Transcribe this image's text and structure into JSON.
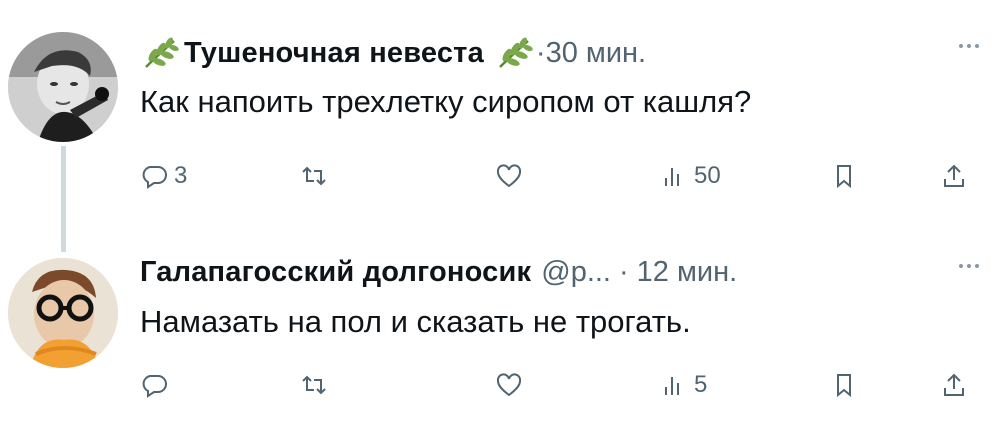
{
  "tweets": [
    {
      "author_name": "Тушеночная невеста",
      "handle": "",
      "time": "30 мин.",
      "text": "Как напоить трехлетку сиропом от кашля?",
      "replies": "3",
      "retweets": "",
      "likes": "",
      "views": "50"
    },
    {
      "author_name": "Галапагосский долгоносик",
      "handle": "@p...",
      "time": "12 мин.",
      "text": "Намазать на пол и сказать не трогать.",
      "replies": "",
      "retweets": "",
      "likes": "",
      "views": "5"
    }
  ],
  "colors": {
    "text": "#0f1419",
    "muted": "#536471",
    "thread_line": "#cfd9de",
    "sprig": "#6a9a3a"
  },
  "icons": [
    "reply-icon",
    "retweet-icon",
    "like-icon",
    "views-icon",
    "bookmark-icon",
    "share-icon",
    "more-icon",
    "sprig-icon"
  ]
}
